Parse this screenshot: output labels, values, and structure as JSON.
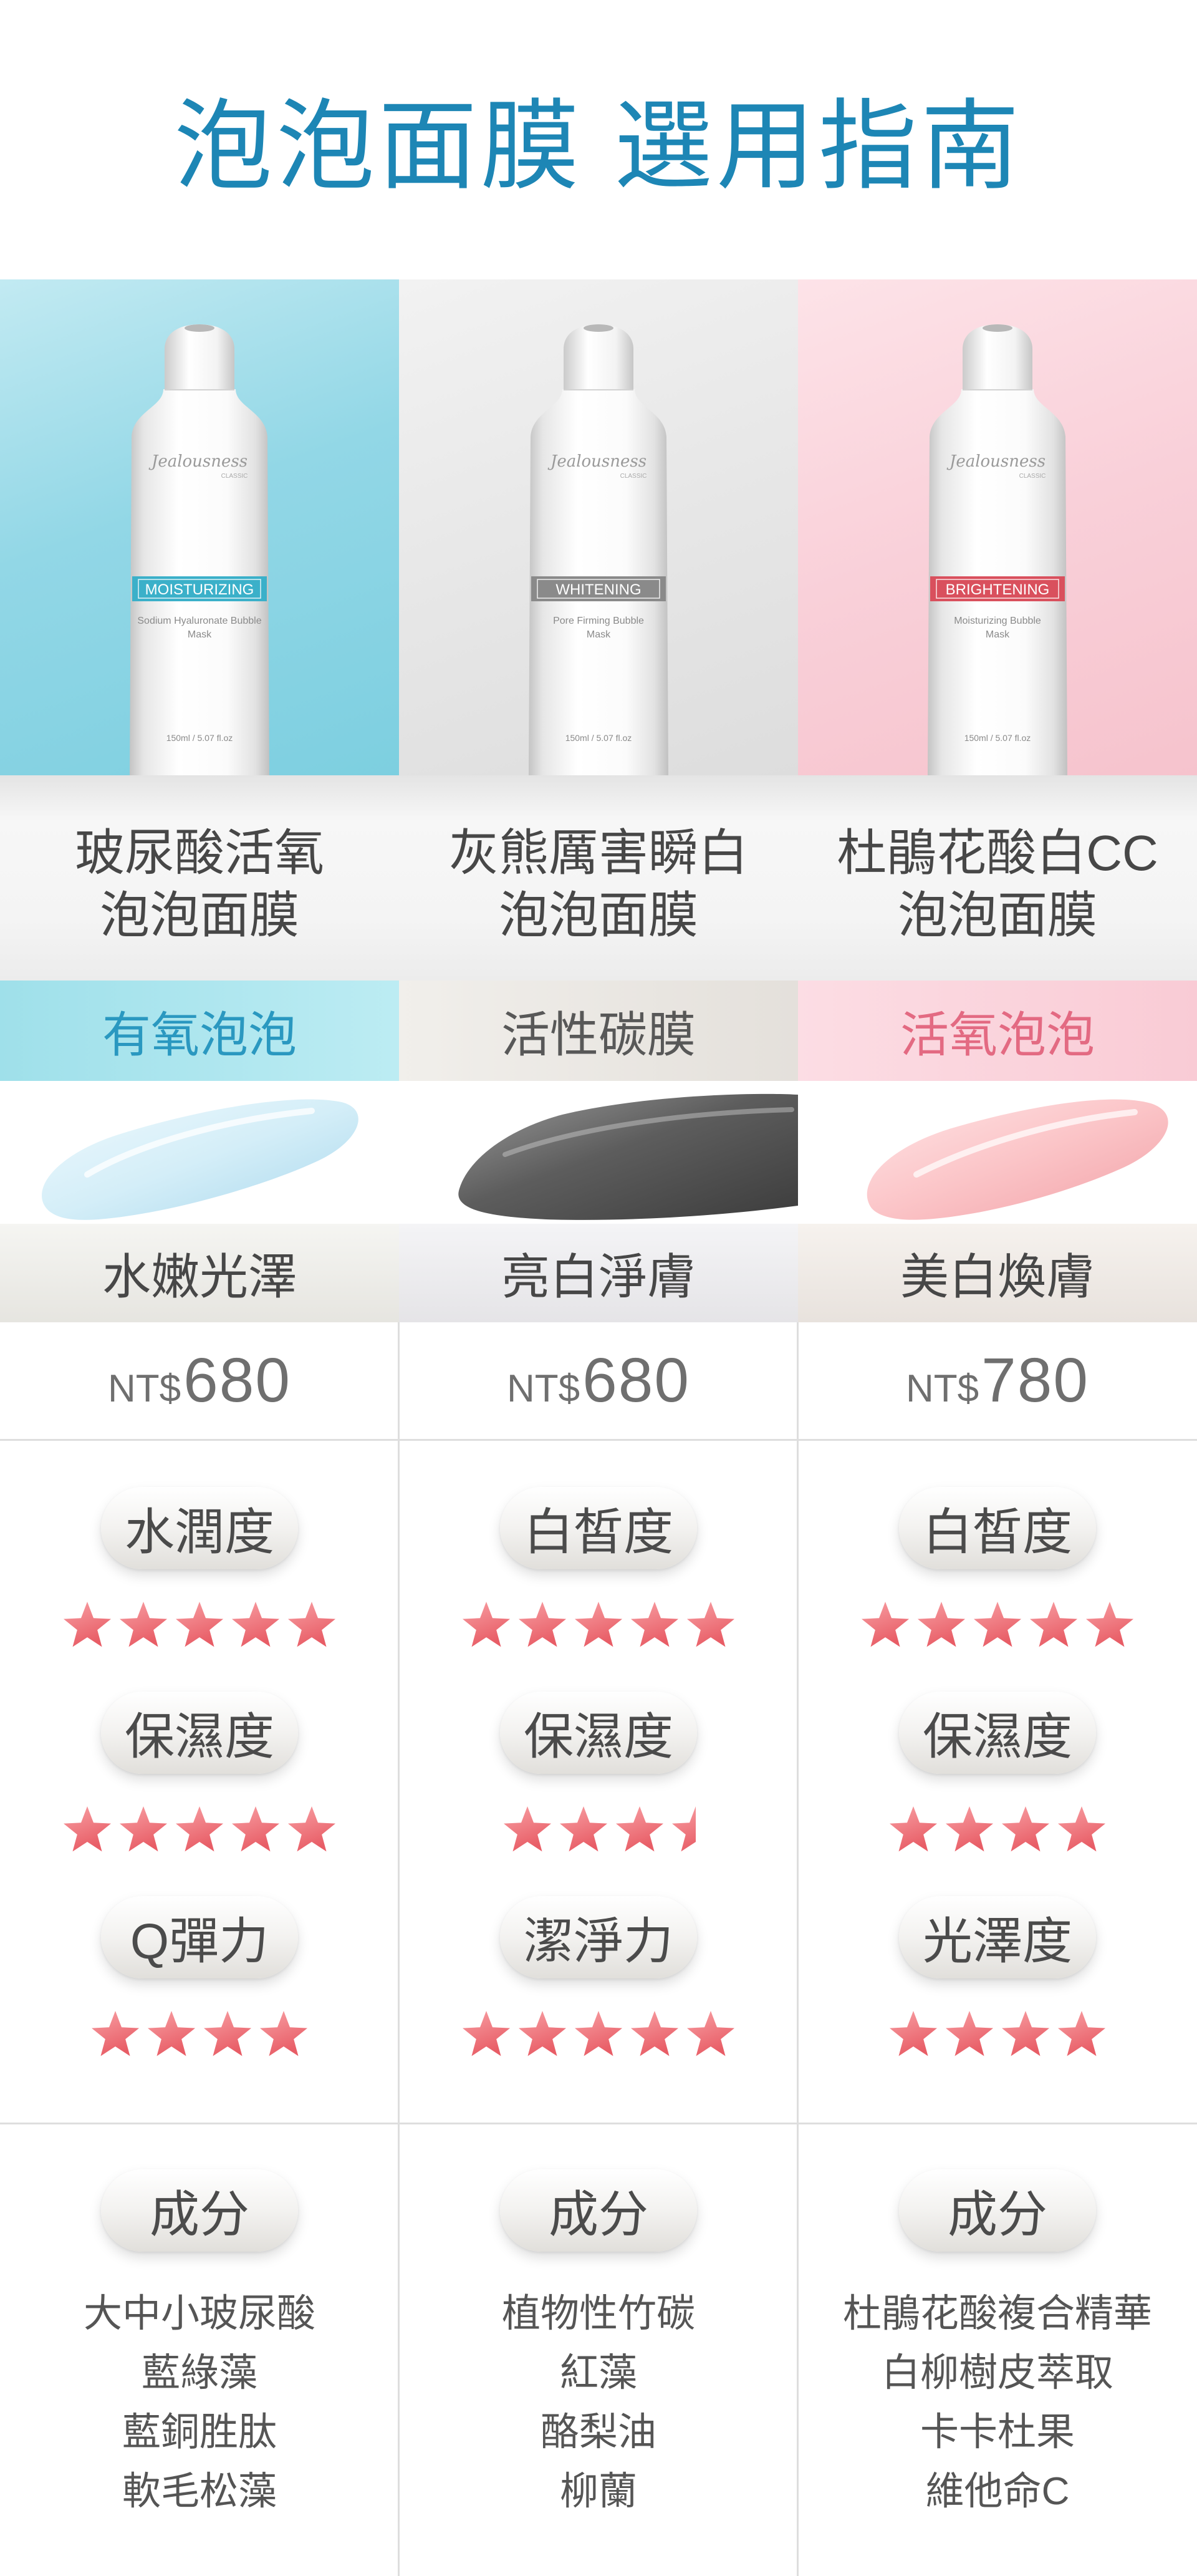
{
  "page": {
    "title": "泡泡面膜 選用指南",
    "title_color": "#1d86b5"
  },
  "star_color": "#e85d66",
  "products": [
    {
      "tube": {
        "brand": "Jealousness",
        "brand_sub": "CLASSIC",
        "band": "MOISTURIZING",
        "band_color": "#3bb0c9",
        "desc_line1": "Sodium Hyaluronate Bubble",
        "desc_line2": "Mask",
        "volume": "150ml / 5.07 fl.oz"
      },
      "name_line1": "玻尿酸活氧",
      "name_line2": "泡泡面膜",
      "tag": "有氧泡泡",
      "tag_color": "#2a98c0",
      "texture_icon": "light-blue-cream-swatch",
      "effect": "水嫩光澤",
      "price_currency": "NT$",
      "price": "680",
      "ratings": [
        {
          "label": "水潤度",
          "stars": 5
        },
        {
          "label": "保濕度",
          "stars": 5
        },
        {
          "label": "Q彈力",
          "stars": 4
        }
      ],
      "ingredients_label": "成分",
      "ingredients": [
        "大中小玻尿酸",
        "藍綠藻",
        "藍銅胜肽",
        "軟毛松藻"
      ]
    },
    {
      "tube": {
        "brand": "Jealousness",
        "brand_sub": "CLASSIC",
        "band": "WHITENING",
        "band_color": "#8a8a8a",
        "desc_line1": "Pore Firming Bubble",
        "desc_line2": "Mask",
        "volume": "150ml / 5.07 fl.oz"
      },
      "name_line1": "灰熊厲害瞬白",
      "name_line2": "泡泡面膜",
      "tag": "活性碳膜",
      "tag_color": "#585858",
      "texture_icon": "charcoal-gray-cream-swatch",
      "effect": "亮白淨膚",
      "price_currency": "NT$",
      "price": "680",
      "ratings": [
        {
          "label": "白皙度",
          "stars": 5
        },
        {
          "label": "保濕度",
          "stars": 3.5
        },
        {
          "label": "潔淨力",
          "stars": 5
        }
      ],
      "ingredients_label": "成分",
      "ingredients": [
        "植物性竹碳",
        "紅藻",
        "酪梨油",
        "柳蘭"
      ]
    },
    {
      "tube": {
        "brand": "Jealousness",
        "brand_sub": "CLASSIC",
        "band": "BRIGHTENING",
        "band_color": "#d9505d",
        "desc_line1": "Moisturizing Bubble",
        "desc_line2": "Mask",
        "volume": "150ml / 5.07 fl.oz"
      },
      "name_line1": "杜鵑花酸白CC",
      "name_line2": "泡泡面膜",
      "tag": "活氧泡泡",
      "tag_color": "#e36a82",
      "texture_icon": "pink-cream-swatch",
      "effect": "美白煥膚",
      "price_currency": "NT$",
      "price": "780",
      "ratings": [
        {
          "label": "白皙度",
          "stars": 5
        },
        {
          "label": "保濕度",
          "stars": 4
        },
        {
          "label": "光澤度",
          "stars": 4
        }
      ],
      "ingredients_label": "成分",
      "ingredients": [
        "杜鵑花酸複合精華",
        "白柳樹皮萃取",
        "卡卡杜果",
        "維他命C"
      ]
    }
  ]
}
